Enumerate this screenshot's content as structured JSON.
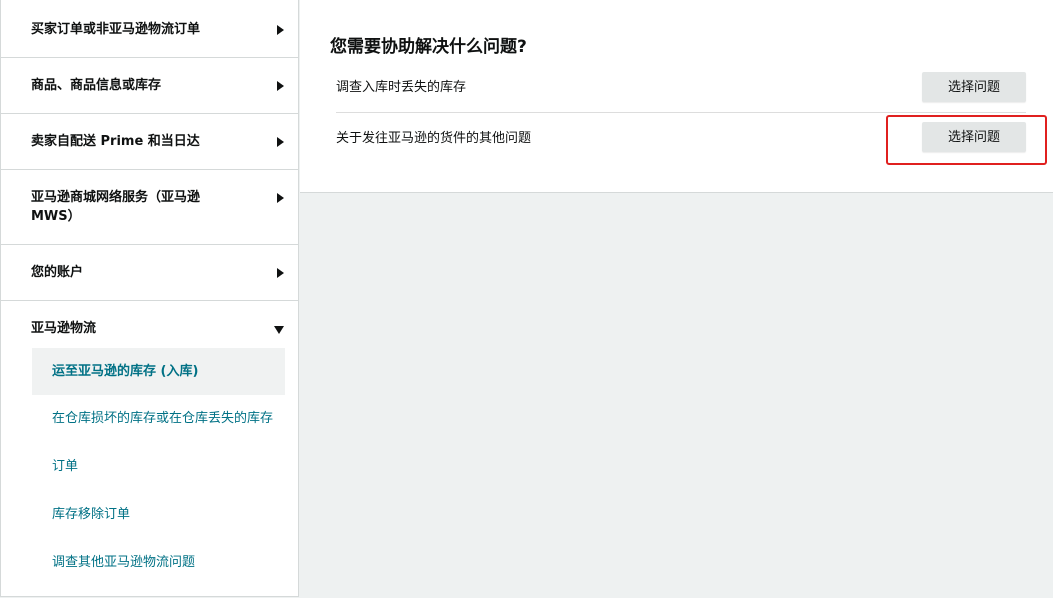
{
  "sidebar": {
    "categories": [
      {
        "label": "买家订单或非亚马逊物流订单",
        "expanded": false
      },
      {
        "label": "商品、商品信息或库存",
        "expanded": false
      },
      {
        "label": "卖家自配送 Prime 和当日达",
        "expanded": false
      },
      {
        "label": "亚马逊商城网络服务（亚马逊 MWS）",
        "expanded": false
      },
      {
        "label": "您的账户",
        "expanded": false
      },
      {
        "label": "亚马逊物流",
        "expanded": true
      }
    ],
    "sub_items": [
      {
        "label": "运至亚马逊的库存 (入库)",
        "active": true
      },
      {
        "label": "在仓库损坏的库存或在仓库丢失的库存",
        "active": false
      },
      {
        "label": "订单",
        "active": false
      },
      {
        "label": "库存移除订单",
        "active": false
      },
      {
        "label": "调查其他亚马逊物流问题",
        "active": false
      }
    ]
  },
  "main": {
    "title": "您需要协助解决什么问题?",
    "questions": [
      {
        "text": "调查入库时丢失的库存",
        "button_label": "选择问题"
      },
      {
        "text": "关于发往亚马逊的货件的其他问题",
        "button_label": "选择问题"
      }
    ]
  },
  "colors": {
    "link": "#007185",
    "highlight": "#e0201f",
    "button_bg": "#e3e6e6"
  }
}
